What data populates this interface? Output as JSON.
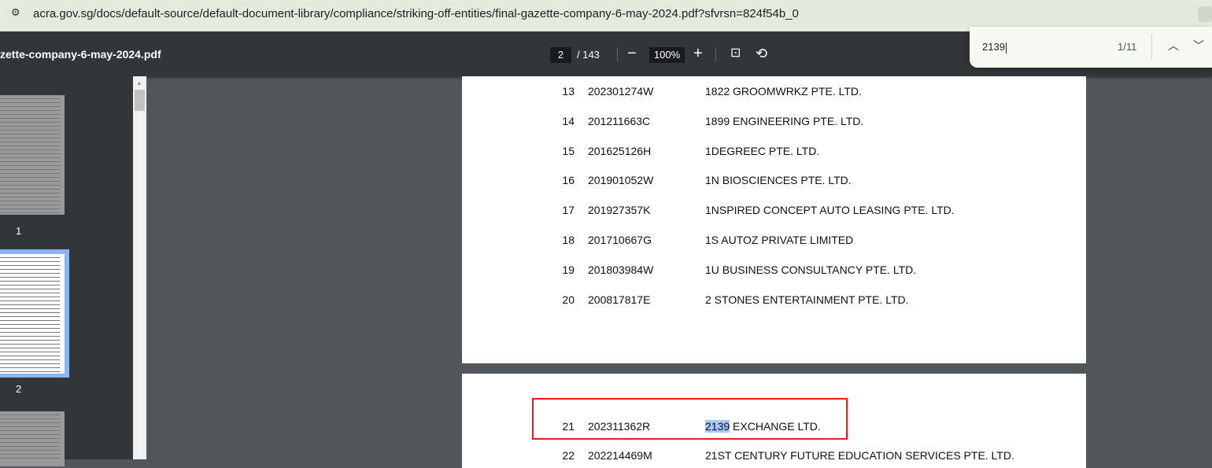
{
  "browser": {
    "url": "acra.gov.sg/docs/default-source/default-document-library/compliance/striking-off-entities/final-gazette-company-6-may-2024.pdf?sfvrsn=824f54b_0"
  },
  "viewer": {
    "filename": "zette-company-6-may-2024.pdf",
    "current_page": "2",
    "total_pages": "/ 143",
    "zoom": "100%"
  },
  "find": {
    "query": "2139",
    "count": "1/11"
  },
  "thumbnails": [
    {
      "label": "1"
    },
    {
      "label": "2"
    }
  ],
  "page_top_rows": [
    {
      "n": "13",
      "id": "202301274W",
      "name": "1822 GROOMWRKZ PTE. LTD."
    },
    {
      "n": "14",
      "id": "201211663C",
      "name": "1899 ENGINEERING PTE. LTD."
    },
    {
      "n": "15",
      "id": "201625126H",
      "name": "1DEGREEC PTE. LTD."
    },
    {
      "n": "16",
      "id": "201901052W",
      "name": "1N BIOSCIENCES PTE. LTD."
    },
    {
      "n": "17",
      "id": "201927357K",
      "name": "1NSPIRED CONCEPT AUTO LEASING PTE. LTD."
    },
    {
      "n": "18",
      "id": "201710667G",
      "name": "1S AUTOZ PRIVATE LIMITED"
    },
    {
      "n": "19",
      "id": "201803984W",
      "name": "1U BUSINESS CONSULTANCY PTE. LTD."
    },
    {
      "n": "20",
      "id": "200817817E",
      "name": "2 STONES ENTERTAINMENT PTE. LTD."
    }
  ],
  "page_next_rows": [
    {
      "n": "21",
      "id": "202311362R",
      "match": "2139",
      "name": " EXCHANGE LTD."
    },
    {
      "n": "22",
      "id": "202214469M",
      "name": "21ST CENTURY FUTURE EDUCATION SERVICES PTE. LTD."
    }
  ]
}
